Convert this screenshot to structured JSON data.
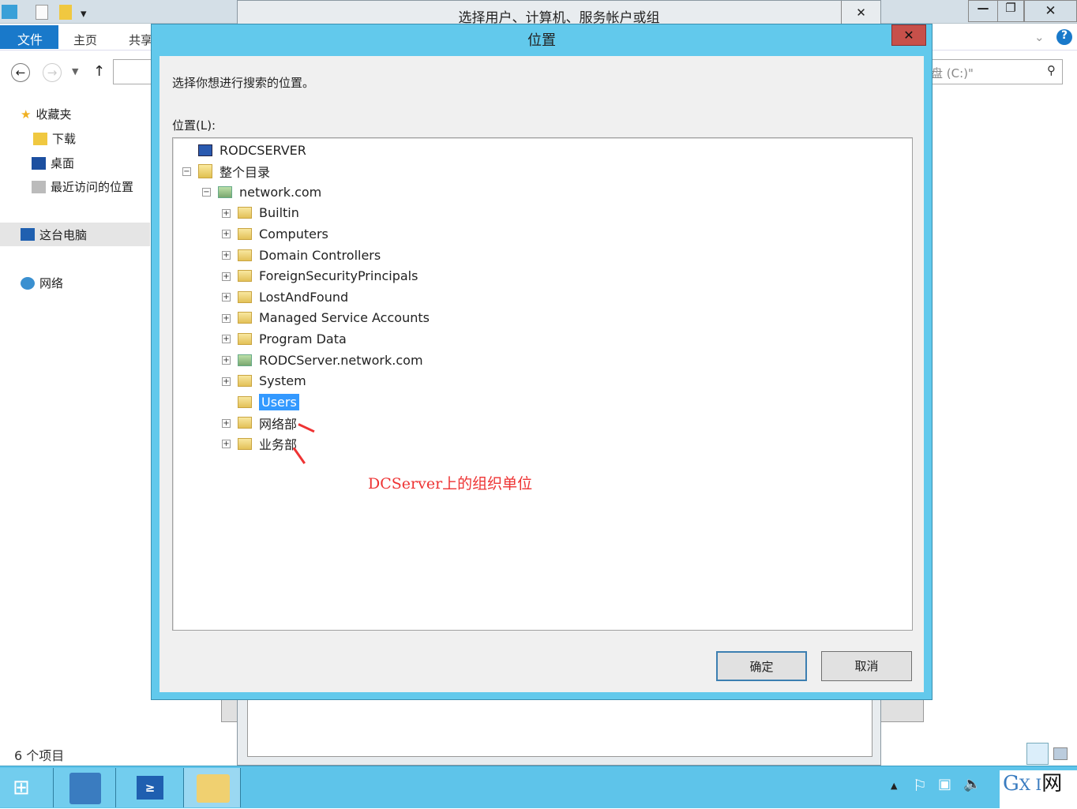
{
  "explorer": {
    "ribbon_tabs": [
      "文件",
      "主页",
      "共享"
    ],
    "search_placeholder": "搜索\"本地磁盘 (C:)\"",
    "search_visible": "盘 (C:)\"",
    "nav": {
      "favorites": "收藏夹",
      "downloads": "下载",
      "desktop": "桌面",
      "recent": "最近访问的位置",
      "this_pc": "这台电脑",
      "network": "网络"
    },
    "status": "6 个项目"
  },
  "back_dialog": {
    "title": "选择用户、计算机、服务帐户或组"
  },
  "dialog": {
    "title": "位置",
    "prompt": "选择你想进行搜索的位置。",
    "tree_label": "位置(L):",
    "ok": "确定",
    "cancel": "取消",
    "tree": [
      {
        "label": "RODCSERVER",
        "level": 0,
        "icon": "computer-icon",
        "expander": "none"
      },
      {
        "label": "整个目录",
        "level": 0,
        "icon": "directory-icon",
        "expander": "minus"
      },
      {
        "label": "network.com",
        "level": 1,
        "icon": "domain-icon",
        "expander": "minus"
      },
      {
        "label": "Builtin",
        "level": 2,
        "icon": "folder-icon",
        "expander": "plus"
      },
      {
        "label": "Computers",
        "level": 2,
        "icon": "folder-icon",
        "expander": "plus"
      },
      {
        "label": "Domain Controllers",
        "level": 2,
        "icon": "folder-icon",
        "expander": "plus"
      },
      {
        "label": "ForeignSecurityPrincipals",
        "level": 2,
        "icon": "folder-icon",
        "expander": "plus"
      },
      {
        "label": "LostAndFound",
        "level": 2,
        "icon": "folder-icon",
        "expander": "plus"
      },
      {
        "label": "Managed Service Accounts",
        "level": 2,
        "icon": "folder-icon",
        "expander": "plus"
      },
      {
        "label": "Program Data",
        "level": 2,
        "icon": "folder-icon",
        "expander": "plus"
      },
      {
        "label": "RODCServer.network.com",
        "level": 2,
        "icon": "domain-icon",
        "expander": "plus"
      },
      {
        "label": "System",
        "level": 2,
        "icon": "folder-icon",
        "expander": "plus"
      },
      {
        "label": "Users",
        "level": 2,
        "icon": "folder-icon",
        "expander": "none",
        "selected": true
      },
      {
        "label": "网络部",
        "level": 2,
        "icon": "folder-icon",
        "expander": "plus"
      },
      {
        "label": "业务部",
        "level": 2,
        "icon": "folder-icon",
        "expander": "plus"
      }
    ]
  },
  "annotation": "DCServer上的组织单位",
  "watermark": "GXI网 system.com",
  "colors": {
    "titlebar": "#62c9ec",
    "close": "#c7504a",
    "selection": "#3399ff",
    "annotation": "#ee3333",
    "taskbar": "#5ec4ea"
  }
}
